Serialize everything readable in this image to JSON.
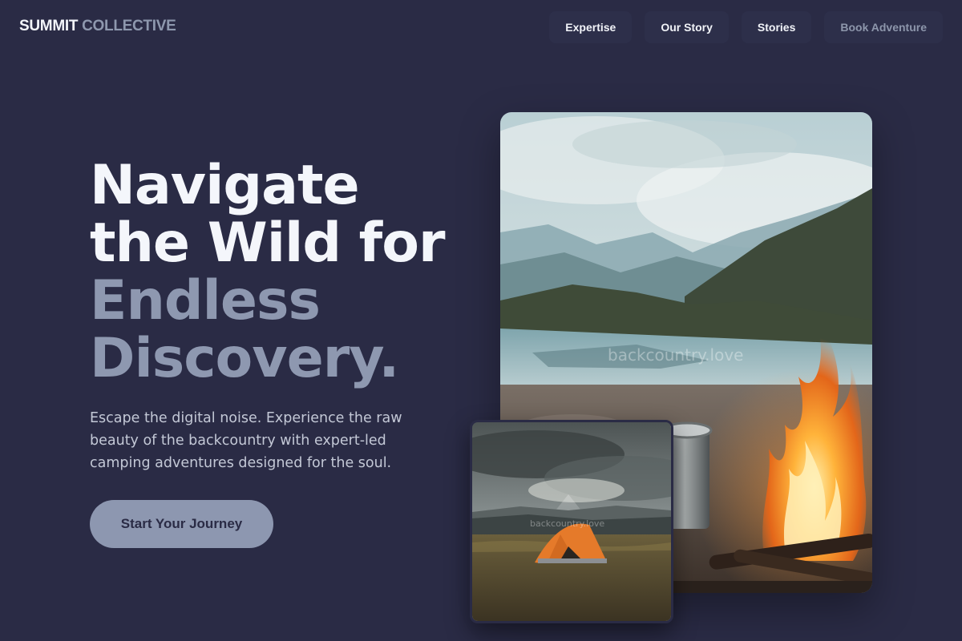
{
  "brand": {
    "part1": "SUMMIT",
    "part2": "COLLECTIVE"
  },
  "nav": {
    "items": [
      {
        "label": "Expertise"
      },
      {
        "label": "Our Story"
      },
      {
        "label": "Stories"
      },
      {
        "label": "Book Adventure"
      }
    ]
  },
  "hero": {
    "headline_lines": [
      "Navigate",
      "the Wild for",
      "Endless",
      "Discovery."
    ],
    "subtitle": "Escape the digital noise. Experience the raw beauty of the backcountry with expert-led camping adventures designed for the soul.",
    "cta_label": "Start Your Journey"
  },
  "images": {
    "main_watermark": "backcountry.love",
    "small_watermark": "backcountry.love"
  },
  "colors": {
    "background": "#2a2b45",
    "accent": "#8d97b0",
    "heading_light": "#f4f6fb",
    "heading_dim": "#8e98b0"
  }
}
